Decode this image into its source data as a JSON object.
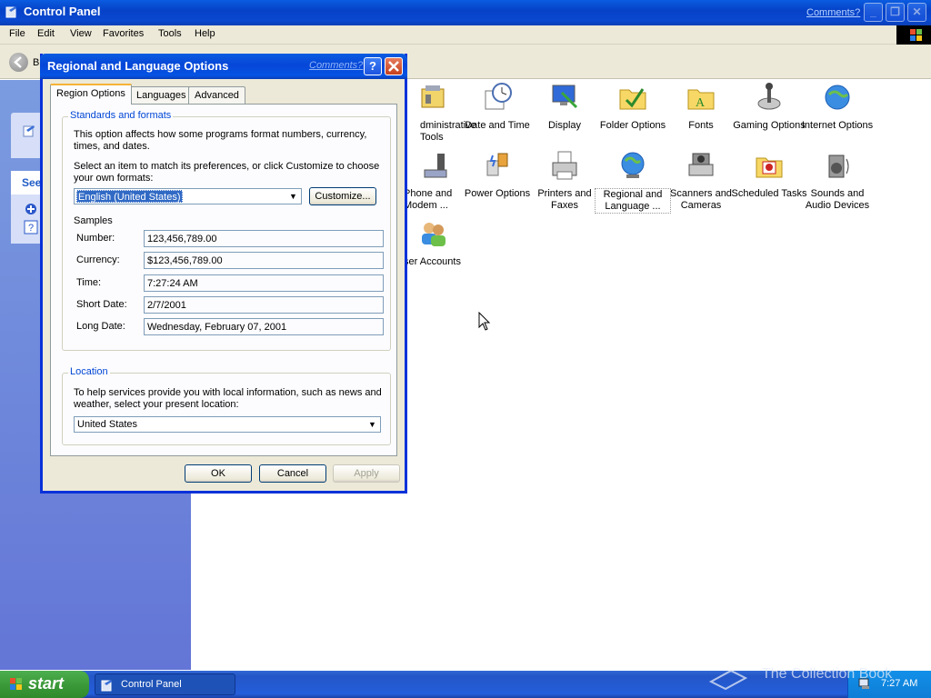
{
  "window": {
    "title": "Control Panel",
    "comments": "Comments?"
  },
  "menu": [
    "File",
    "Edit",
    "View",
    "Favorites",
    "Tools",
    "Help"
  ],
  "toolbar": {
    "back_label": "B"
  },
  "left_pane": {
    "see_also_header": "See"
  },
  "control_panel_items": [
    {
      "label": "dministrative Tools",
      "icon": "administrative-tools-icon"
    },
    {
      "label": "Date and Time",
      "icon": "date-time-icon"
    },
    {
      "label": "Display",
      "icon": "display-icon"
    },
    {
      "label": "Folder Options",
      "icon": "folder-options-icon"
    },
    {
      "label": "Fonts",
      "icon": "fonts-icon"
    },
    {
      "label": "Gaming Options",
      "icon": "gaming-options-icon"
    },
    {
      "label": "Internet Options",
      "icon": "internet-options-icon"
    },
    {
      "label": "Phone and Modem ...",
      "icon": "phone-modem-icon"
    },
    {
      "label": "Power Options",
      "icon": "power-options-icon"
    },
    {
      "label": "Printers and Faxes",
      "icon": "printers-faxes-icon"
    },
    {
      "label": "Regional and Language ...",
      "icon": "regional-language-icon"
    },
    {
      "label": "Scanners and Cameras",
      "icon": "scanners-cameras-icon"
    },
    {
      "label": "Scheduled Tasks",
      "icon": "scheduled-tasks-icon"
    },
    {
      "label": "Sounds and Audio Devices",
      "icon": "sounds-audio-icon"
    },
    {
      "label": "ser Accounts",
      "icon": "user-accounts-icon"
    }
  ],
  "dialog": {
    "title": "Regional and Language Options",
    "comments": "Comments?",
    "help": "?",
    "tabs": [
      "Region Options",
      "Languages",
      "Advanced"
    ],
    "standards": {
      "legend": "Standards and formats",
      "desc": "This option affects how some programs format numbers, currency, times, and dates.",
      "select_text": "Select an item to match its preferences, or click Customize to choose your own formats:",
      "selected_locale": "English (United States)",
      "customize": "Customize...",
      "samples_label": "Samples",
      "samples": [
        {
          "label": "Number:",
          "value": "123,456,789.00"
        },
        {
          "label": "Currency:",
          "value": "$123,456,789.00"
        },
        {
          "label": "Time:",
          "value": "7:27:24 AM"
        },
        {
          "label": "Short Date:",
          "value": "2/7/2001"
        },
        {
          "label": "Long Date:",
          "value": "Wednesday, February 07, 2001"
        }
      ]
    },
    "location": {
      "legend": "Location",
      "desc": "To help services provide you with local information, such as news and weather, select your present location:",
      "value": "United States"
    },
    "buttons": {
      "ok": "OK",
      "cancel": "Cancel",
      "apply": "Apply"
    }
  },
  "taskbar": {
    "start": "start",
    "task": "Control Panel",
    "clock": "7:27 AM"
  },
  "watermark": "The Collection Book"
}
